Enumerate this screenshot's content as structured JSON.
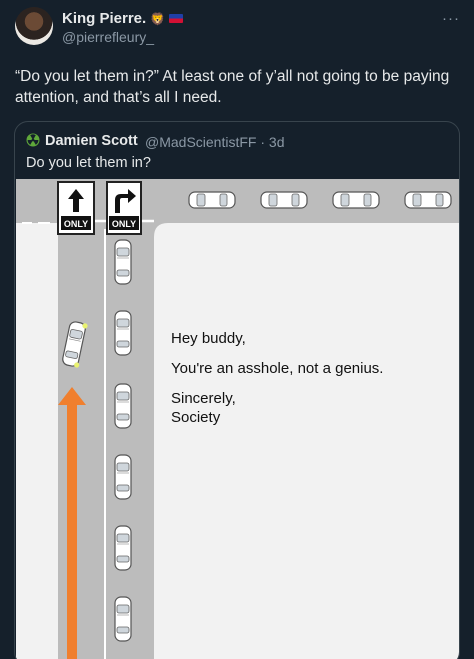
{
  "tweet": {
    "author_name": "King Pierre.",
    "author_emojis": [
      "🦁",
      "🇭🇹"
    ],
    "author_handle": "@pierrefleury_",
    "more_icon": "more-dots-icon",
    "text": "“Do you let them in?” At least one of y’all not going to be paying attention, and that’s all I need."
  },
  "quote": {
    "author_name": "Damien Scott",
    "author_handle": "@MadScientistFF · 3d",
    "avatar_icon": "radiation-icon",
    "text": "Do you let them in?"
  },
  "meme": {
    "sign_left": "ONLY",
    "sign_right": "ONLY",
    "caption": {
      "line1": "Hey buddy,",
      "line2": "You're an asshole, not a genius.",
      "line3": "Sincerely,",
      "line4": "Society"
    },
    "colors": {
      "arrow": "#f07f2e",
      "road": "#bcbcbc",
      "lane_line": "#ffffff",
      "ground": "#f2f2f2"
    }
  }
}
